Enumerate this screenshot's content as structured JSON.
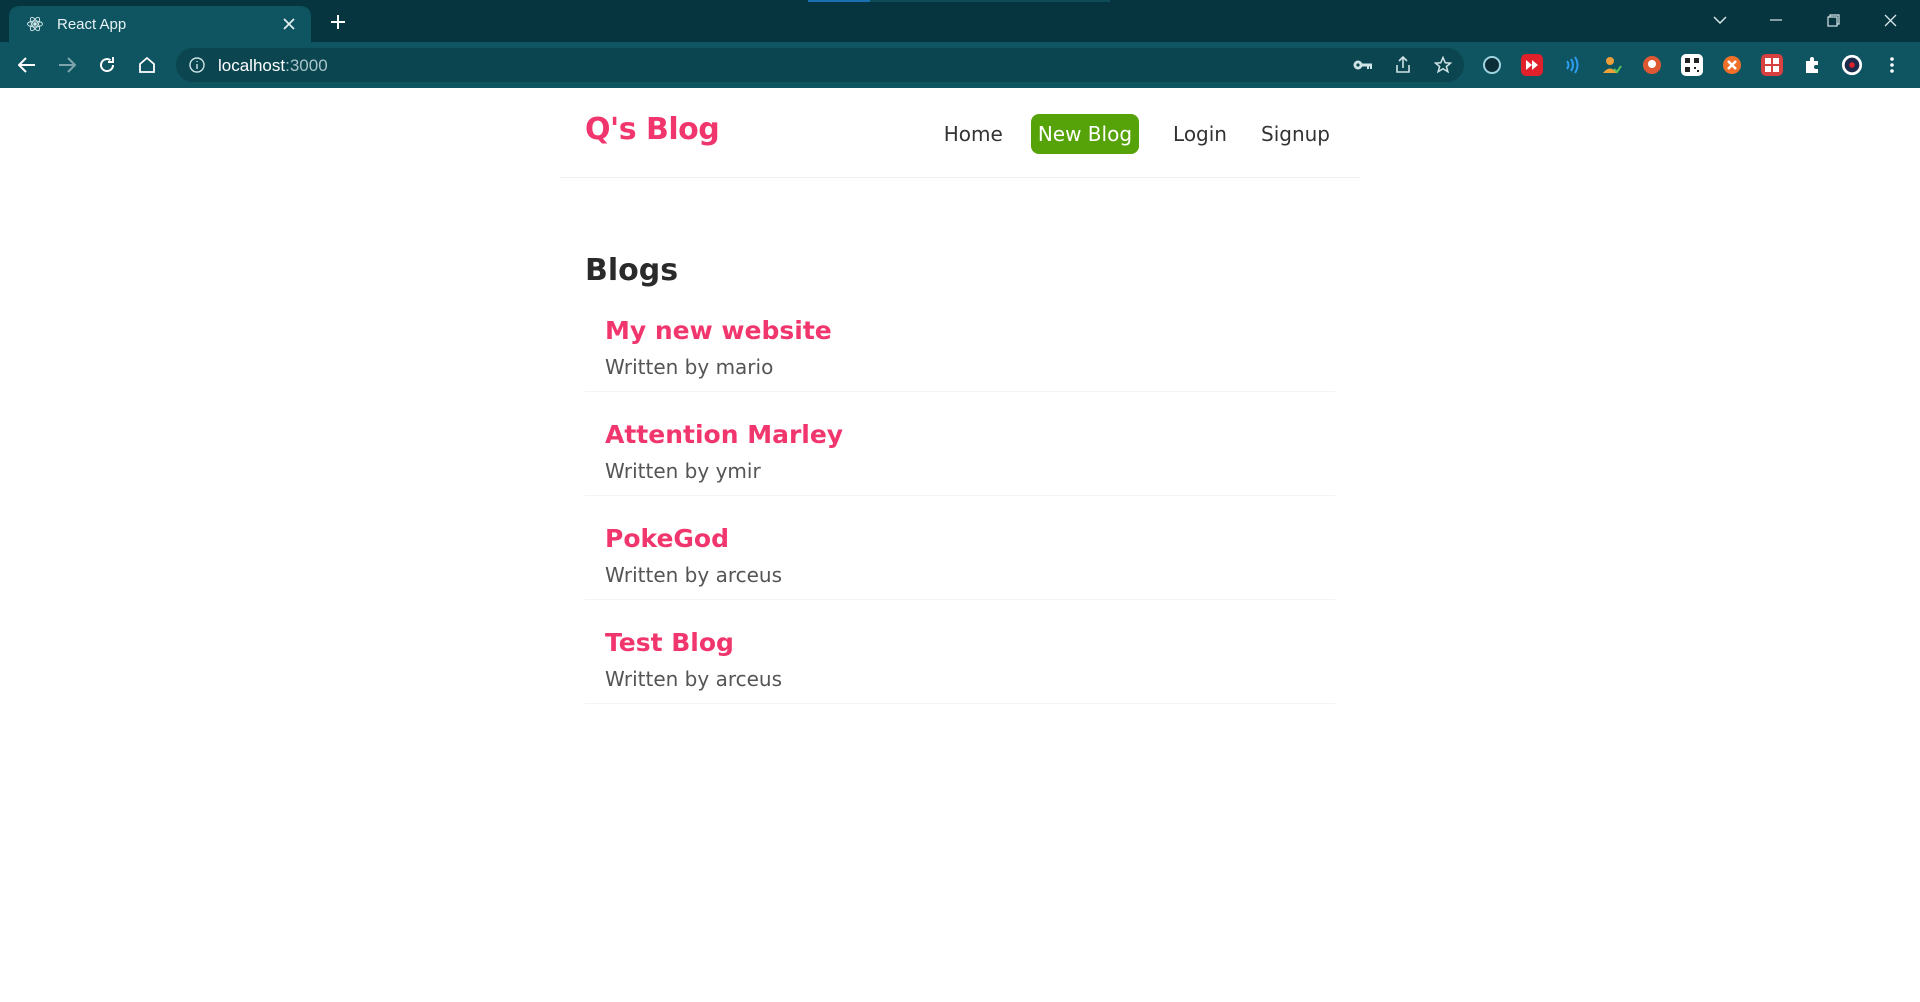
{
  "browser": {
    "tab_title": "React App",
    "url_host": "localhost",
    "url_port": ":3000"
  },
  "site": {
    "brand": "Q's Blog",
    "nav": [
      "Home",
      "New Blog",
      "Login",
      "Signup"
    ],
    "active_nav": "New Blog",
    "accent_color": "#f1356d",
    "active_nav_color": "#55a308"
  },
  "main": {
    "heading": "Blogs",
    "blogs": [
      {
        "title": "My new website",
        "author_line": "Written by mario"
      },
      {
        "title": "Attention Marley",
        "author_line": "Written by ymir"
      },
      {
        "title": "PokeGod",
        "author_line": "Written by arceus"
      },
      {
        "title": "Test Blog",
        "author_line": "Written by arceus"
      }
    ]
  },
  "icons": [
    "react-icon",
    "close-icon",
    "plus-icon",
    "chevron-down-icon",
    "minimize-icon",
    "restore-icon",
    "back-icon",
    "forward-icon",
    "reload-icon",
    "home-icon",
    "info-icon",
    "key-icon",
    "share-icon",
    "star-icon",
    "extensions-icon",
    "profile-icon",
    "menu-icon"
  ]
}
